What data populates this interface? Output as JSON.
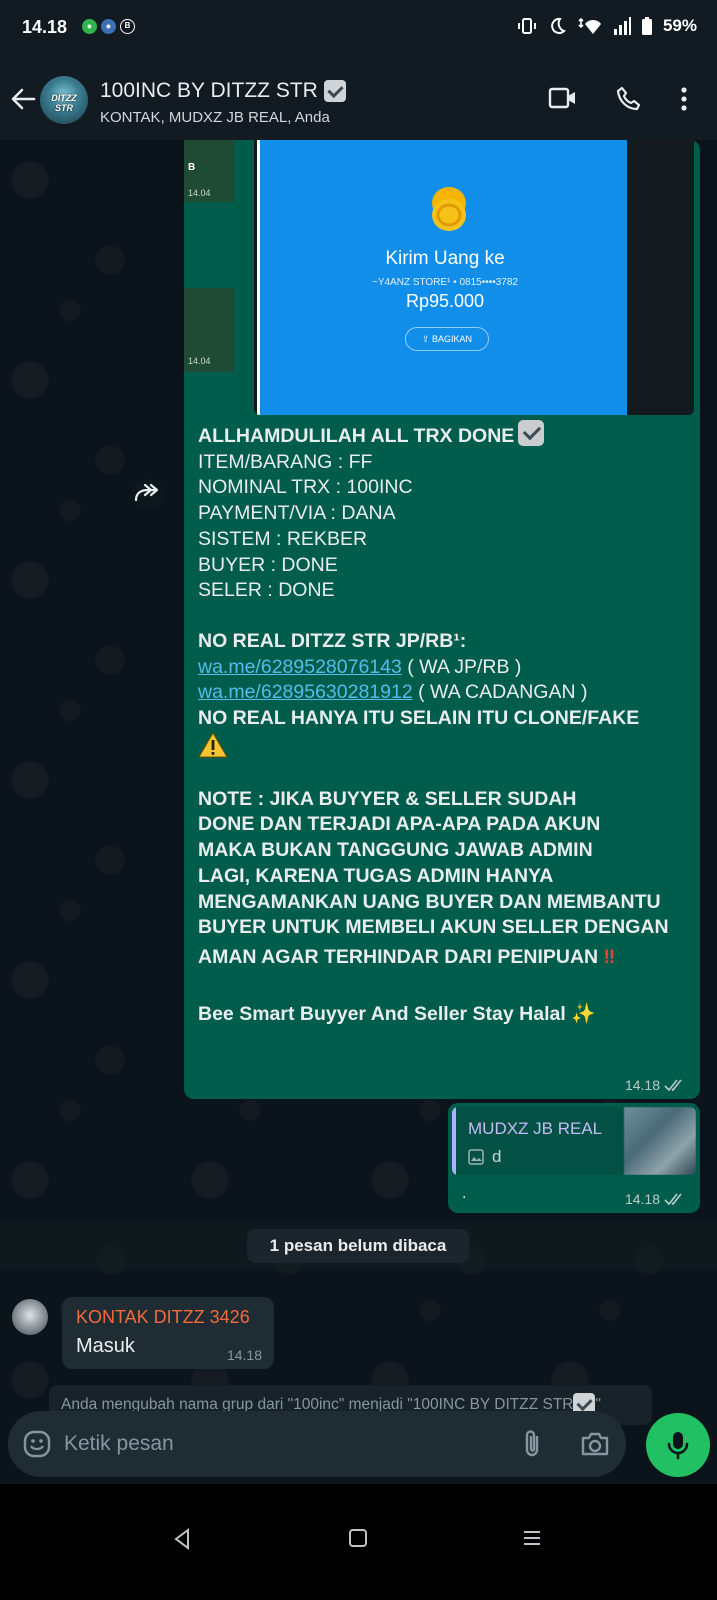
{
  "status_bar": {
    "time": "14.18",
    "battery": "59%"
  },
  "header": {
    "title": "100INC BY DITZZ STR",
    "members": "KONTAK, MUDXZ JB REAL, Anda",
    "avatar_text": "DITZZ STR"
  },
  "thumbs": [
    {
      "time": "14.04",
      "label": "B"
    },
    {
      "time": "14.04"
    }
  ],
  "image_msg": {
    "title": "Kirim Uang ke",
    "recipient": "~Y4ANZ STORE¹ • 0815••••3782",
    "amount": "Rp95.000",
    "share": "BAGIKAN"
  },
  "main_message": {
    "headline": "ALLHAMDULILAH ALL TRX DONE",
    "lines": [
      "ITEM/BARANG : FF",
      "NOMINAL TRX : 100INC",
      "PAYMENT/VIA : DANA",
      "SISTEM : REKBER",
      "BUYER : DONE",
      "SELER : DONE"
    ],
    "no_real_title": "NO REAL DITZZ STR JP/RB¹:",
    "link1": "wa.me/6289528076143",
    "link1_note": " ( WA JP/RB )",
    "link2": "wa.me/62895630281912",
    "link2_note": " ( WA CADANGAN )",
    "clone_warning": "NO REAL HANYA ITU SELAIN ITU CLONE/FAKE",
    "note_lines": [
      "NOTE : JIKA BUYYER & SELLER SUDAH",
      "DONE DAN TERJADI APA-APA PADA AKUN",
      "MAKA BUKAN TANGGUNG JAWAB ADMIN",
      "LAGI, KARENA TUGAS ADMIN HANYA",
      "MENGAMANKAN UANG BUYER DAN MEMBANTU",
      "BUYER UNTUK MEMBELI AKUN SELLER DENGAN",
      "AMAN AGAR TERHINDAR DARI PENIPUAN"
    ],
    "note_emoji": "‼",
    "closing": "Bee Smart Buyyer And Seller Stay Halal",
    "closing_emoji": "✨",
    "time": "14.18"
  },
  "reply_message": {
    "quoted_name": "MUDXZ JB REAL",
    "quoted_text": "d",
    "text": ".",
    "time": "14.18"
  },
  "unread": "1 pesan belum dibaca",
  "incoming": {
    "sender": "KONTAK DITZZ 3426",
    "text": "Masuk",
    "time": "14.18"
  },
  "system_message": {
    "prefix": "Anda mengubah nama grup dari \"100inc\" menjadi \"100INC BY DITZZ STR",
    "suffix": "\""
  },
  "composer": {
    "placeholder": "Ketik pesan"
  },
  "colors": {
    "outgoing_bubble": "#005c4b",
    "incoming_bubble": "#202c33",
    "link": "#53bdeb",
    "sender_name": "#f26b3a",
    "mic_button": "#21c063"
  }
}
